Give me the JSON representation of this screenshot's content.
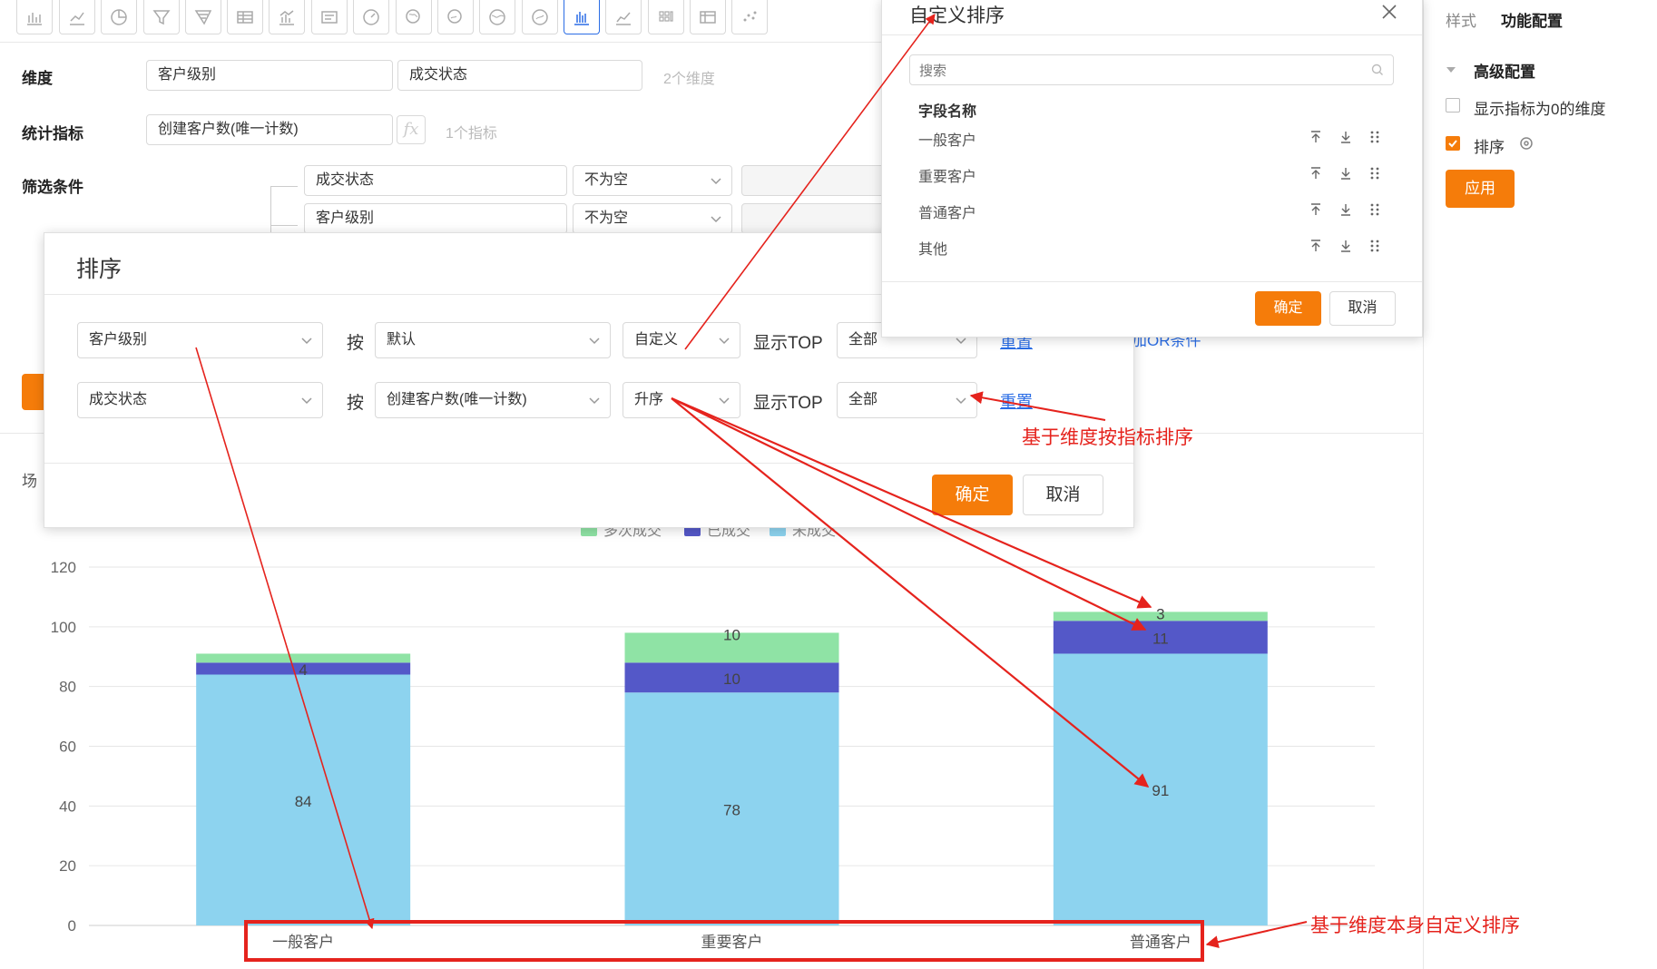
{
  "form": {
    "dimension_label": "维度",
    "dimensions": [
      "客户级别",
      "成交状态"
    ],
    "dimension_count": "2个维度",
    "metric_label": "统计指标",
    "metric": "创建客户数(唯一计数)",
    "metric_count": "1个指标",
    "filter_label": "筛选条件",
    "filters": [
      {
        "field": "成交状态",
        "op": "不为空"
      },
      {
        "field": "客户级别",
        "op": "不为空"
      }
    ],
    "scene_label_partial": "场",
    "or_partial": "加OR条件",
    "fx_label": "fx"
  },
  "right_panel": {
    "tab_style": "样式",
    "tab_function": "功能配置",
    "advanced_title": "高级配置",
    "opt_show_zero": "显示指标为0的维度",
    "opt_sort": "排序",
    "apply_label": "应用"
  },
  "sort_dialog": {
    "title": "排序",
    "rows": [
      {
        "dimension": "客户级别",
        "by_label": "按",
        "basis": "默认",
        "order": "自定义",
        "top_label": "显示TOP",
        "top": "全部",
        "reset": "重置"
      },
      {
        "dimension": "成交状态",
        "by_label": "按",
        "basis": "创建客户数(唯一计数)",
        "order": "升序",
        "top_label": "显示TOP",
        "top": "全部",
        "reset": "重置"
      }
    ],
    "ok": "确定",
    "cancel": "取消"
  },
  "custom_sort": {
    "title": "自定义排序",
    "search_placeholder": "搜索",
    "header": "字段名称",
    "items": [
      "一般客户",
      "重要客户",
      "普通客户",
      "其他"
    ],
    "ok": "确定",
    "cancel": "取消"
  },
  "annotations": {
    "metric_sort": "基于维度按指标排序",
    "custom_sort": "基于维度本身自定义排序"
  },
  "colors": {
    "accent": "#f57c0a",
    "annotation": "#e5231d",
    "link": "#2b6de5"
  },
  "chart_data": {
    "type": "bar",
    "stacked": true,
    "categories": [
      "一般客户",
      "重要客户",
      "普通客户"
    ],
    "series": [
      {
        "name": "多次成交",
        "color": "#8fe3a5",
        "values": [
          3,
          10,
          3
        ]
      },
      {
        "name": "已成交",
        "color": "#5458c8",
        "values": [
          4,
          10,
          11
        ]
      },
      {
        "name": "未成交",
        "color": "#8dd3ef",
        "values": [
          84,
          78,
          91
        ]
      }
    ],
    "data_labels": [
      [
        "",
        "10",
        "3"
      ],
      [
        "4",
        "10",
        "11"
      ],
      [
        "84",
        "78",
        "91"
      ]
    ],
    "ylim": [
      0,
      120
    ],
    "yticks": [
      0,
      20,
      40,
      60,
      80,
      100,
      120
    ],
    "grid": true,
    "legend": "top"
  }
}
